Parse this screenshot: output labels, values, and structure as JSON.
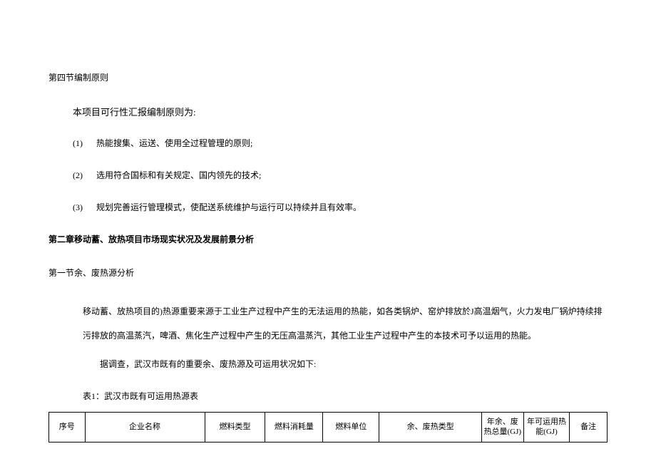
{
  "section4": {
    "heading": "第四节编制原则",
    "intro": "本项目可行性汇报编制原则为:",
    "items": [
      {
        "num": "(1)",
        "text": "热能搜集、运送、使用全过程管理的原则;"
      },
      {
        "num": "(2)",
        "text": "选用符合国标和有关规定、国内领先的技术;"
      },
      {
        "num": "(3)",
        "text": "规划完善运行管理模式，使配送系统维护与运行可以持续并且有效率。"
      }
    ]
  },
  "chapter2": {
    "heading": "第二章移动蓄、放热项目市场现实状况及发展前景分析",
    "section1": {
      "heading": "第一节余、废热源分析",
      "paragraph": "移动蓄、放热项目的)热源重要来源于工业生产过程中产生的无法运用的热能，如各类锅炉、窑炉排放於J高温烟气，火力发电厂锅炉持续排污排放的高温蒸汽，啤酒、焦化生产过程中产生的无压高温蒸汽，其他工业生产过程中产生的本技术可予以运用的热能。",
      "survey_line": "据调查，武汉市既有的重要余、废热源及可运用状况如下:",
      "table_caption": "表1：武汉市既有可运用热源表"
    }
  },
  "table": {
    "headers": [
      "序号",
      "企业名称",
      "燃料类型",
      "燃料消耗量",
      "燃料单位",
      "余、废热类型",
      "年余、废热总量(GJ)",
      "年可运用热能(GJ)",
      "备注"
    ]
  },
  "chart_data": {
    "type": "table",
    "title": "武汉市既有可运用热源表",
    "columns": [
      "序号",
      "企业名称",
      "燃料类型",
      "燃料消耗量",
      "燃料单位",
      "余、废热类型",
      "年余、废热总量(GJ)",
      "年可运用热能(GJ)",
      "备注"
    ],
    "rows": []
  }
}
